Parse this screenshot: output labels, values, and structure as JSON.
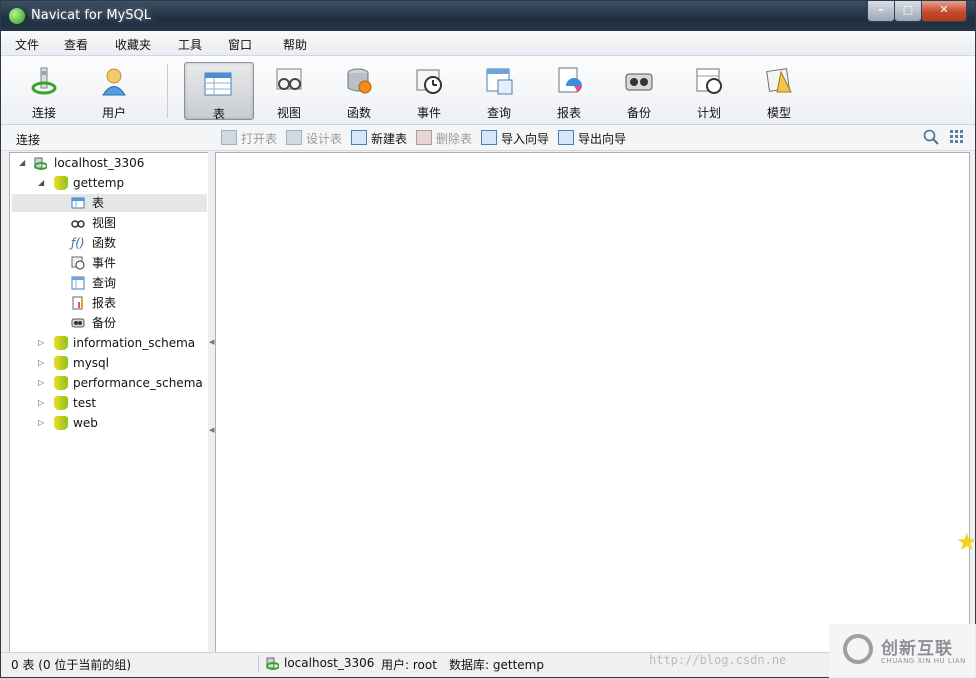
{
  "window": {
    "title": "Navicat for MySQL",
    "min": "–",
    "max": "□",
    "close": "✕"
  },
  "menu": [
    "文件",
    "查看",
    "收藏夹",
    "工具",
    "窗口",
    "帮助"
  ],
  "toolbar": [
    {
      "label": "连接",
      "icon": "connection-icon",
      "active": false
    },
    {
      "label": "用户",
      "icon": "user-icon",
      "active": false
    },
    {
      "label": "表",
      "icon": "table-icon",
      "active": true
    },
    {
      "label": "视图",
      "icon": "view-icon",
      "active": false
    },
    {
      "label": "函数",
      "icon": "function-icon",
      "active": false
    },
    {
      "label": "事件",
      "icon": "event-icon",
      "active": false
    },
    {
      "label": "查询",
      "icon": "query-icon",
      "active": false
    },
    {
      "label": "报表",
      "icon": "report-icon",
      "active": false
    },
    {
      "label": "备份",
      "icon": "backup-icon",
      "active": false
    },
    {
      "label": "计划",
      "icon": "schedule-icon",
      "active": false
    },
    {
      "label": "模型",
      "icon": "model-icon",
      "active": false
    }
  ],
  "subbar": {
    "left_label": "连接",
    "actions": [
      {
        "label": "打开表",
        "enabled": false
      },
      {
        "label": "设计表",
        "enabled": false
      },
      {
        "label": "新建表",
        "enabled": true
      },
      {
        "label": "删除表",
        "enabled": false
      },
      {
        "label": "导入向导",
        "enabled": true
      },
      {
        "label": "导出向导",
        "enabled": true
      }
    ]
  },
  "tree": {
    "connection": "localhost_3306",
    "open_db": "gettemp",
    "objects": [
      "表",
      "视图",
      "函数",
      "事件",
      "查询",
      "报表",
      "备份"
    ],
    "selected_object": "表",
    "other_dbs": [
      "information_schema",
      "mysql",
      "performance_schema",
      "test",
      "web"
    ]
  },
  "status": {
    "count": "0 表 (0 位于当前的组)",
    "connection": "localhost_3306",
    "user": "用户: root",
    "database": "数据库: gettemp"
  },
  "watermark": "http://blog.csdn.ne",
  "brand": {
    "cn": "创新互联",
    "en": "CHUANG XIN HU LIAN"
  },
  "colors": {
    "titlebar": "#1f2f40",
    "selection": "#e4e6e8",
    "db_icon": "#8bc219",
    "close": "#c44b2b"
  }
}
